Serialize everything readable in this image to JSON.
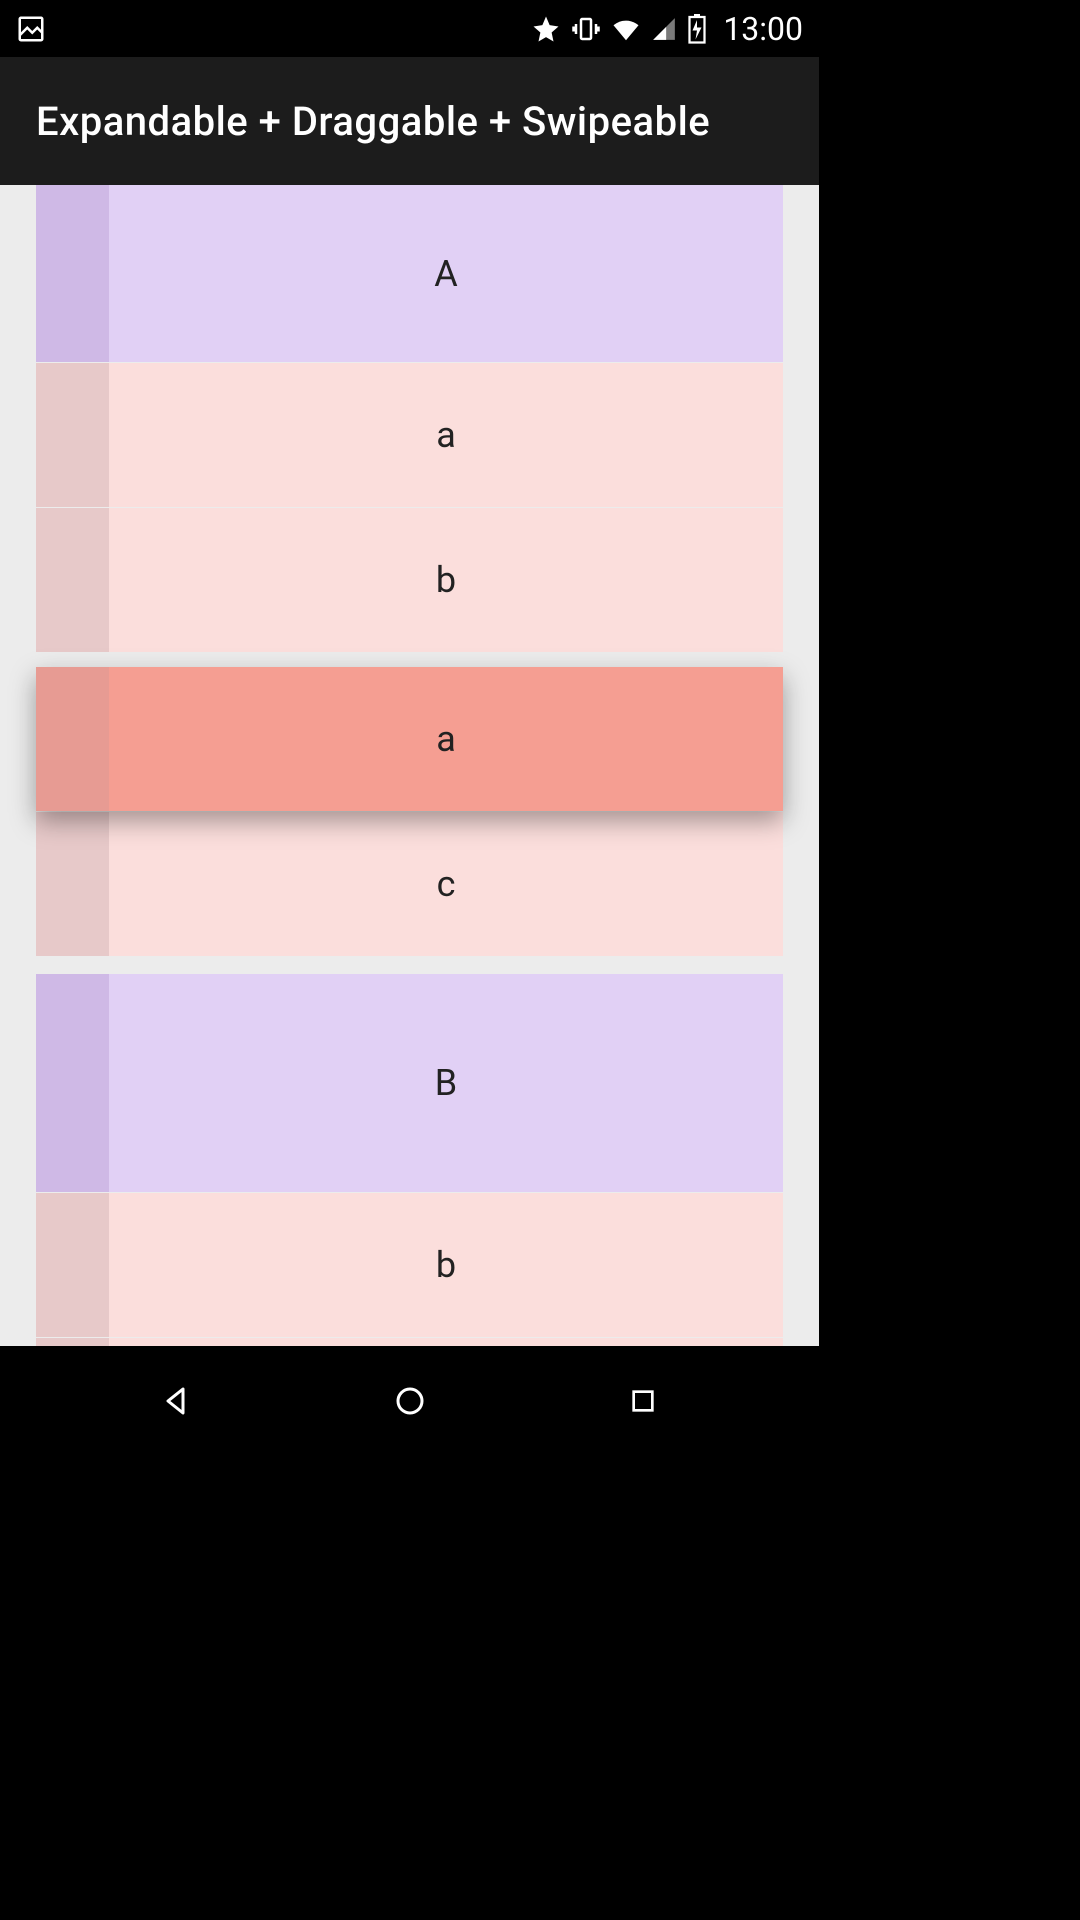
{
  "status": {
    "time": "13:00"
  },
  "app": {
    "title": "Expandable + Draggable + Swipeable"
  },
  "list": {
    "items": [
      {
        "type": "header",
        "label": "A",
        "color": "purple",
        "clippedTop": true
      },
      {
        "type": "child",
        "label": "a",
        "color": "pink"
      },
      {
        "type": "child",
        "label": "b",
        "color": "pink"
      },
      {
        "type": "child",
        "label": "a",
        "color": "pink",
        "dragging": true
      },
      {
        "type": "child",
        "label": "c",
        "color": "pink",
        "last": true
      },
      {
        "type": "header",
        "label": "B",
        "color": "purple2"
      },
      {
        "type": "child",
        "label": "b",
        "color": "pink"
      }
    ]
  },
  "nav": {
    "back": "back",
    "home": "home",
    "recent": "recent"
  }
}
